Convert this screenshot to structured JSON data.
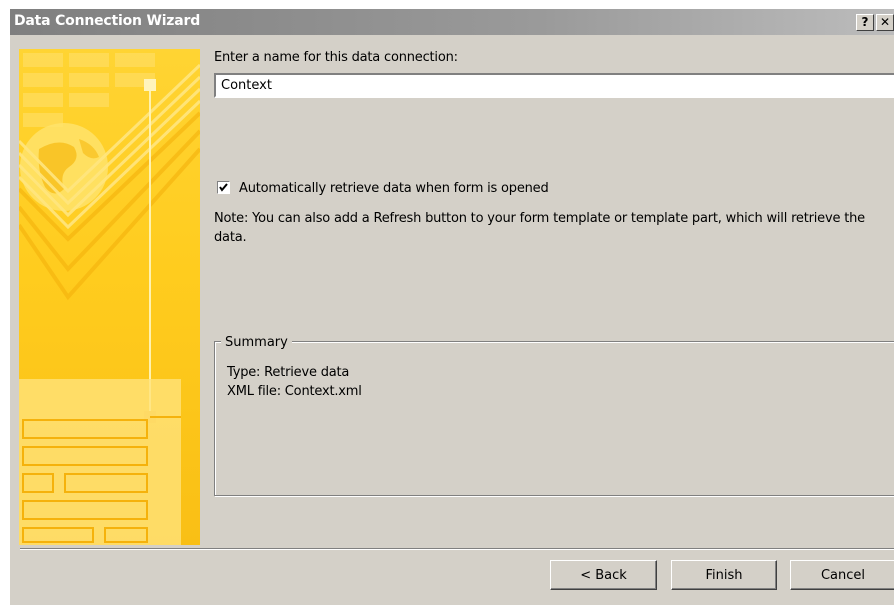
{
  "window": {
    "title": "Data Connection Wizard",
    "help_button": "?",
    "close_button": "✕"
  },
  "form": {
    "name_label": "Enter a name for this data connection:",
    "name_value": "Context",
    "auto_retrieve_checked": true,
    "auto_retrieve_label": "Automatically retrieve data when form is opened",
    "note": "Note: You can also add a Refresh button to your form template or template part, which will retrieve the data."
  },
  "summary": {
    "title": "Summary",
    "type_line": "Type: Retrieve data",
    "xml_line": "XML file: Context.xml"
  },
  "buttons": {
    "back": "< Back",
    "finish": "Finish",
    "cancel": "Cancel"
  },
  "colors": {
    "dialog_background": "#d4d0c8",
    "sidebar_yellow": "#ffcc1e",
    "titlebar_gray": "#8c8c8c"
  }
}
